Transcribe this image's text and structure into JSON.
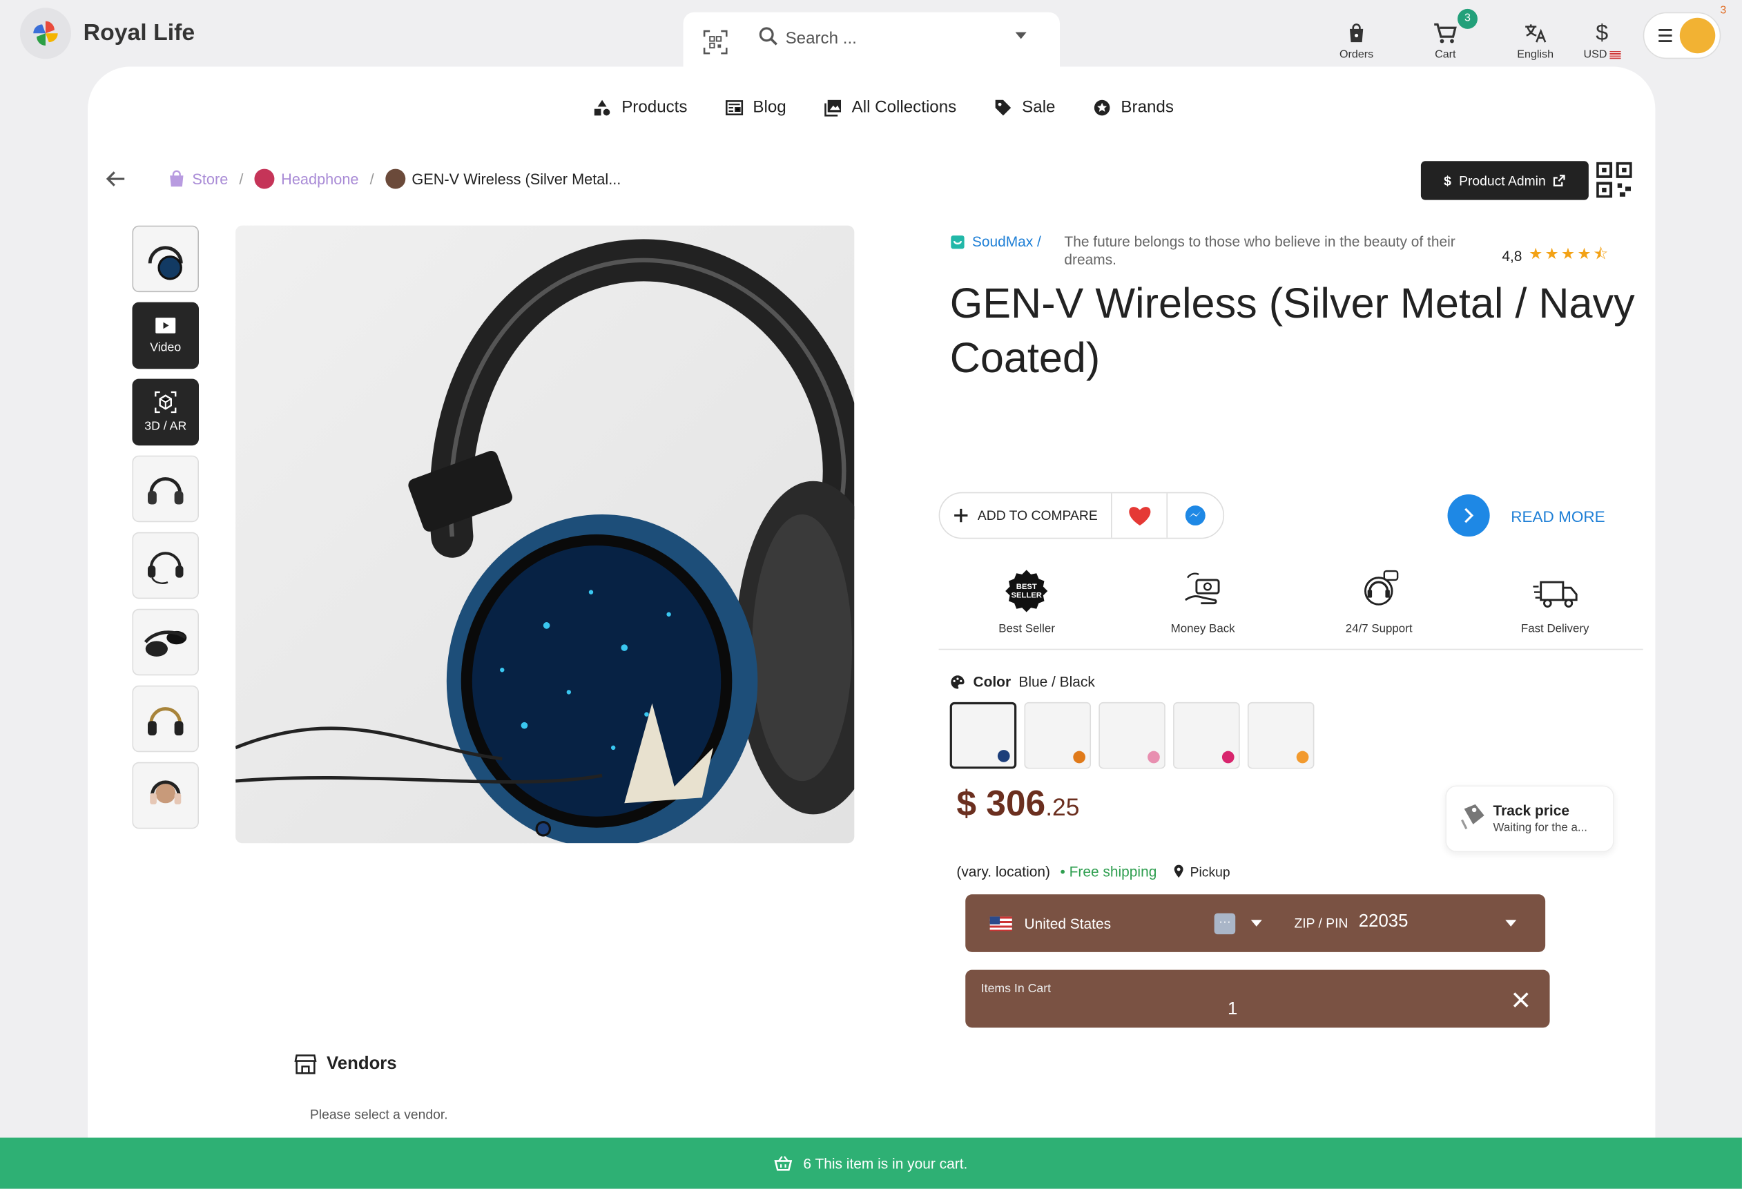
{
  "app": {
    "title": "Royal Life"
  },
  "search": {
    "placeholder": "Search ..."
  },
  "top_actions": [
    {
      "label": "Orders",
      "icon": "bag-icon"
    },
    {
      "label": "Cart",
      "icon": "cart-icon",
      "badge": "3"
    },
    {
      "label": "English",
      "icon": "translate-icon"
    },
    {
      "label": "USD",
      "icon": "dollar-icon"
    }
  ],
  "user": {
    "badge": "3"
  },
  "menu": [
    {
      "label": "Products",
      "icon": "shapes-icon"
    },
    {
      "label": "Blog",
      "icon": "newspaper-icon"
    },
    {
      "label": "All Collections",
      "icon": "images-icon"
    },
    {
      "label": "Sale",
      "icon": "tag-icon"
    },
    {
      "label": "Brands",
      "icon": "star-badge-icon"
    }
  ],
  "breadcrumb": {
    "store": "Store",
    "category": "Headphone",
    "current": "GEN-V Wireless (Silver Metal..."
  },
  "admin": {
    "label": "Product Admin"
  },
  "thumbnails": [
    {
      "type": "image"
    },
    {
      "type": "video",
      "label": "Video"
    },
    {
      "type": "ar",
      "label": "3D / AR"
    },
    {
      "type": "image"
    },
    {
      "type": "image"
    },
    {
      "type": "image"
    },
    {
      "type": "image"
    },
    {
      "type": "image"
    }
  ],
  "product": {
    "brand": "SoudMax /",
    "quote": "The future belongs to those who believe in the beauty of their dreams.",
    "rating": "4,8",
    "stars": "★★★★⯪",
    "title": "GEN-V Wireless (Silver Metal / Navy Coated)",
    "compare_label": "ADD TO COMPARE",
    "read_more": "READ MORE",
    "features": [
      {
        "label": "Best Seller"
      },
      {
        "label": "Money Back"
      },
      {
        "label": "24/7 Support"
      },
      {
        "label": "Fast Delivery"
      }
    ],
    "color_label": "Color",
    "color_value": "Blue / Black",
    "swatches": [
      "#1c3e7a",
      "#e07a1a",
      "#e88fb0",
      "#d8256d",
      "#f29a2e"
    ],
    "price_main": "$ 306",
    "price_cents": ".25",
    "track_title": "Track price",
    "track_sub": "Waiting for the a...",
    "ship_note": "(vary. location)",
    "ship_free": "• Free shipping",
    "pickup": "Pickup",
    "country": "United States",
    "zip_label": "ZIP / PIN",
    "zip_value": "22035",
    "cart_label": "Items In Cart",
    "cart_qty": "1"
  },
  "vendors": {
    "title": "Vendors",
    "sub": "Please select a vendor."
  },
  "banner": {
    "text": "6 This item is in your cart."
  },
  "colors": {
    "accent": "#1e88e5",
    "brown": "#7a5243",
    "green": "#2eb074",
    "price": "#6b2f1f"
  }
}
